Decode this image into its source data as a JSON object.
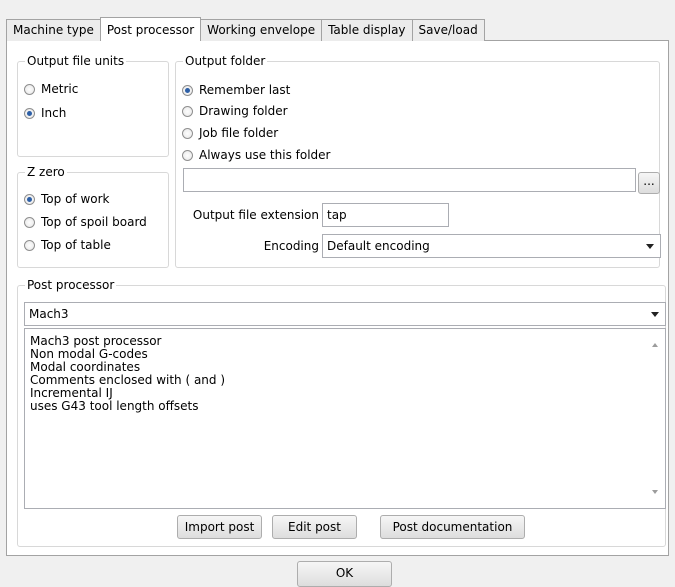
{
  "tabs": [
    {
      "label": "Machine type"
    },
    {
      "label": "Post processor"
    },
    {
      "label": "Working envelope"
    },
    {
      "label": "Table display"
    },
    {
      "label": "Save/load"
    }
  ],
  "active_tab": 1,
  "output_file_units": {
    "legend": "Output file units",
    "options": [
      {
        "label": "Metric",
        "checked": false
      },
      {
        "label": "Inch",
        "checked": true
      }
    ]
  },
  "z_zero": {
    "legend": "Z zero",
    "options": [
      {
        "label": "Top of work",
        "checked": true
      },
      {
        "label": "Top of spoil board",
        "checked": false
      },
      {
        "label": "Top of table",
        "checked": false
      }
    ]
  },
  "output_folder": {
    "legend": "Output folder",
    "options": [
      {
        "label": "Remember last",
        "checked": true
      },
      {
        "label": "Drawing folder",
        "checked": false
      },
      {
        "label": "Job file folder",
        "checked": false
      },
      {
        "label": "Always use this folder",
        "checked": false
      }
    ],
    "folder_path": "",
    "browse_label": "...",
    "extension_label": "Output file extension",
    "extension_value": "tap",
    "encoding_label": "Encoding",
    "encoding_value": "Default encoding"
  },
  "post_processor": {
    "legend": "Post processor",
    "selected": "Mach3",
    "description": [
      "Mach3 post processor",
      "",
      "Non modal G-codes",
      "Modal coordinates",
      "Comments enclosed with ( and )",
      "Incremental IJ",
      "uses G43 tool length offsets"
    ],
    "import_label": "Import post",
    "edit_label": "Edit post",
    "docs_label": "Post documentation"
  },
  "ok_label": "OK"
}
